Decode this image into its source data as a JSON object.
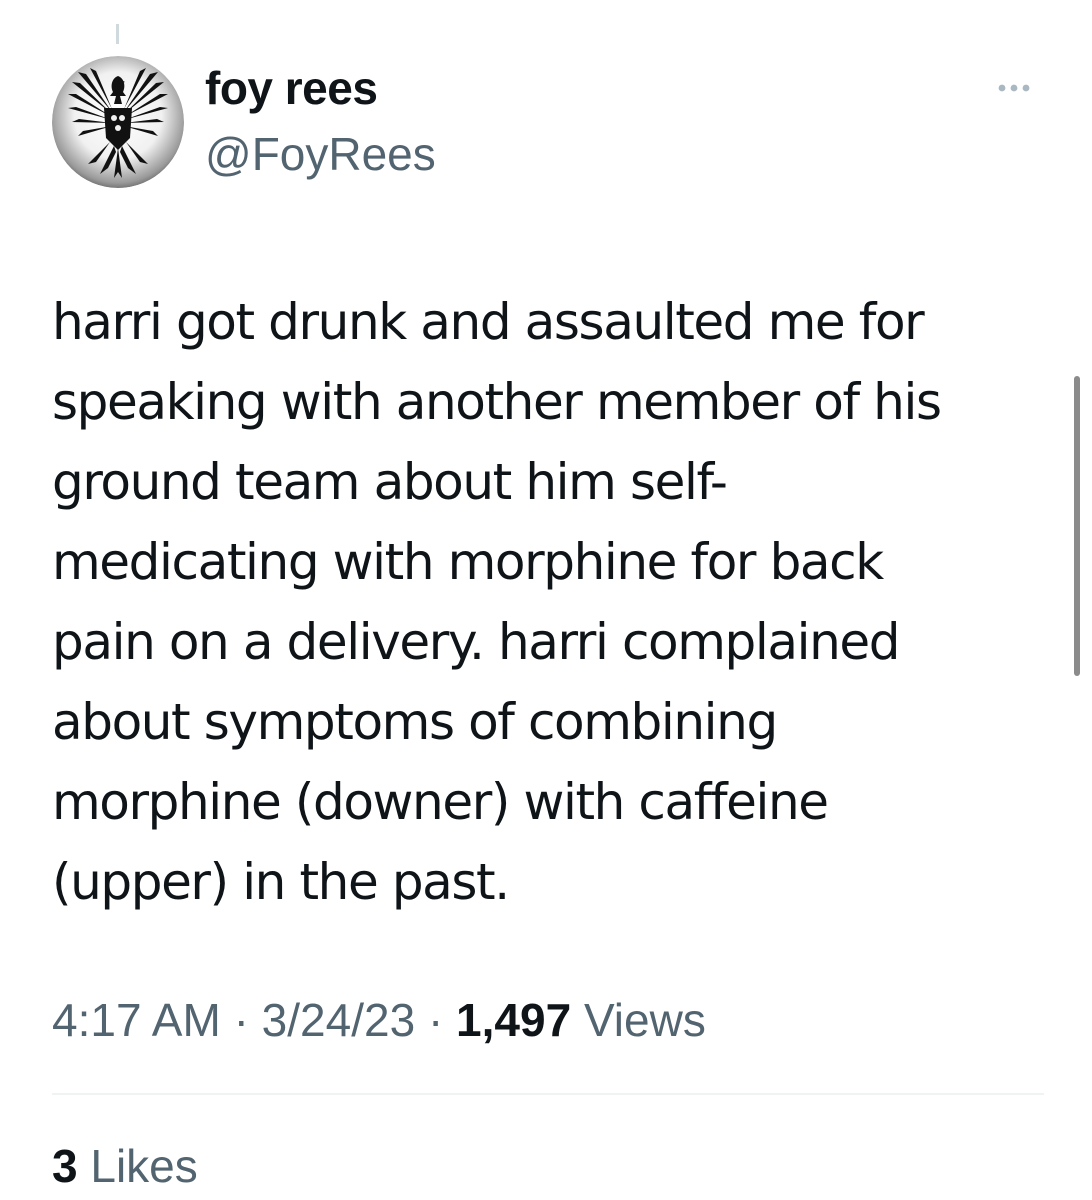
{
  "author": {
    "name": "foy rees",
    "handle": "@FoyRees",
    "avatar_icon": "phoenix-crest-icon"
  },
  "tweet": {
    "text": "harri got drunk and assaulted me for\nspeaking with another member of his\nground team about him self-\nmedicating with morphine for back\npain on a delivery. harri complained\nabout symptoms of combining\nmorphine (downer) with caffeine\n(upper) in the past."
  },
  "meta": {
    "time": "4:17 AM",
    "separator": "·",
    "date": "3/24/23",
    "views_count": "1,497",
    "views_label": "Views"
  },
  "engagement": {
    "likes_count": "3",
    "likes_label": "Likes"
  },
  "icons": {
    "more": "more-horizontal-icon"
  },
  "colors": {
    "text_primary": "#0f1419",
    "text_secondary": "#536471",
    "divider": "#eff3f4",
    "more_icon": "#aab8c2"
  }
}
